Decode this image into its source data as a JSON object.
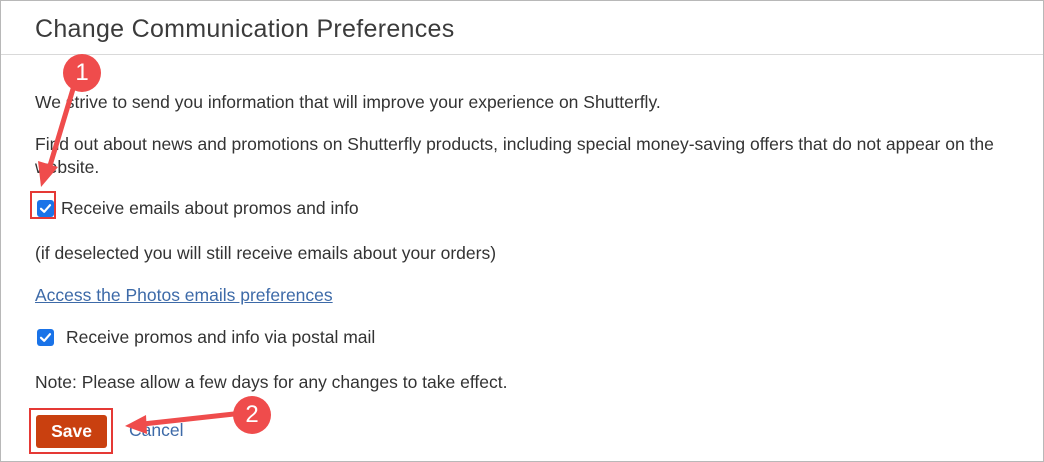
{
  "header": {
    "title": "Change Communication Preferences"
  },
  "content": {
    "intro": "We strive to send you information that will improve your experience on Shutterfly.",
    "news_text": "Find out about news and promotions on Shutterfly products, including special money-saving offers that do not appear on the website.",
    "email_checkbox": {
      "label": "Receive emails about promos and info",
      "checked": true
    },
    "email_note": "(if deselected you will still receive emails about your orders)",
    "photos_link": "Access the Photos emails preferences",
    "postal_checkbox": {
      "label": "Receive promos and info via postal mail",
      "checked": true
    },
    "note": "Note: Please allow a few days for any changes to take effect."
  },
  "actions": {
    "save_label": "Save",
    "cancel_label": "Cancel"
  },
  "annotations": {
    "step1": "1",
    "step2": "2"
  },
  "colors": {
    "accent_save": "#c9400f",
    "checkbox": "#1a73e8",
    "link": "#3d6aa8",
    "annotation": "#ef4c4c"
  },
  "icons": {
    "checkbox": "checkmark-icon",
    "annotation_arrow": "arrow-icon"
  }
}
